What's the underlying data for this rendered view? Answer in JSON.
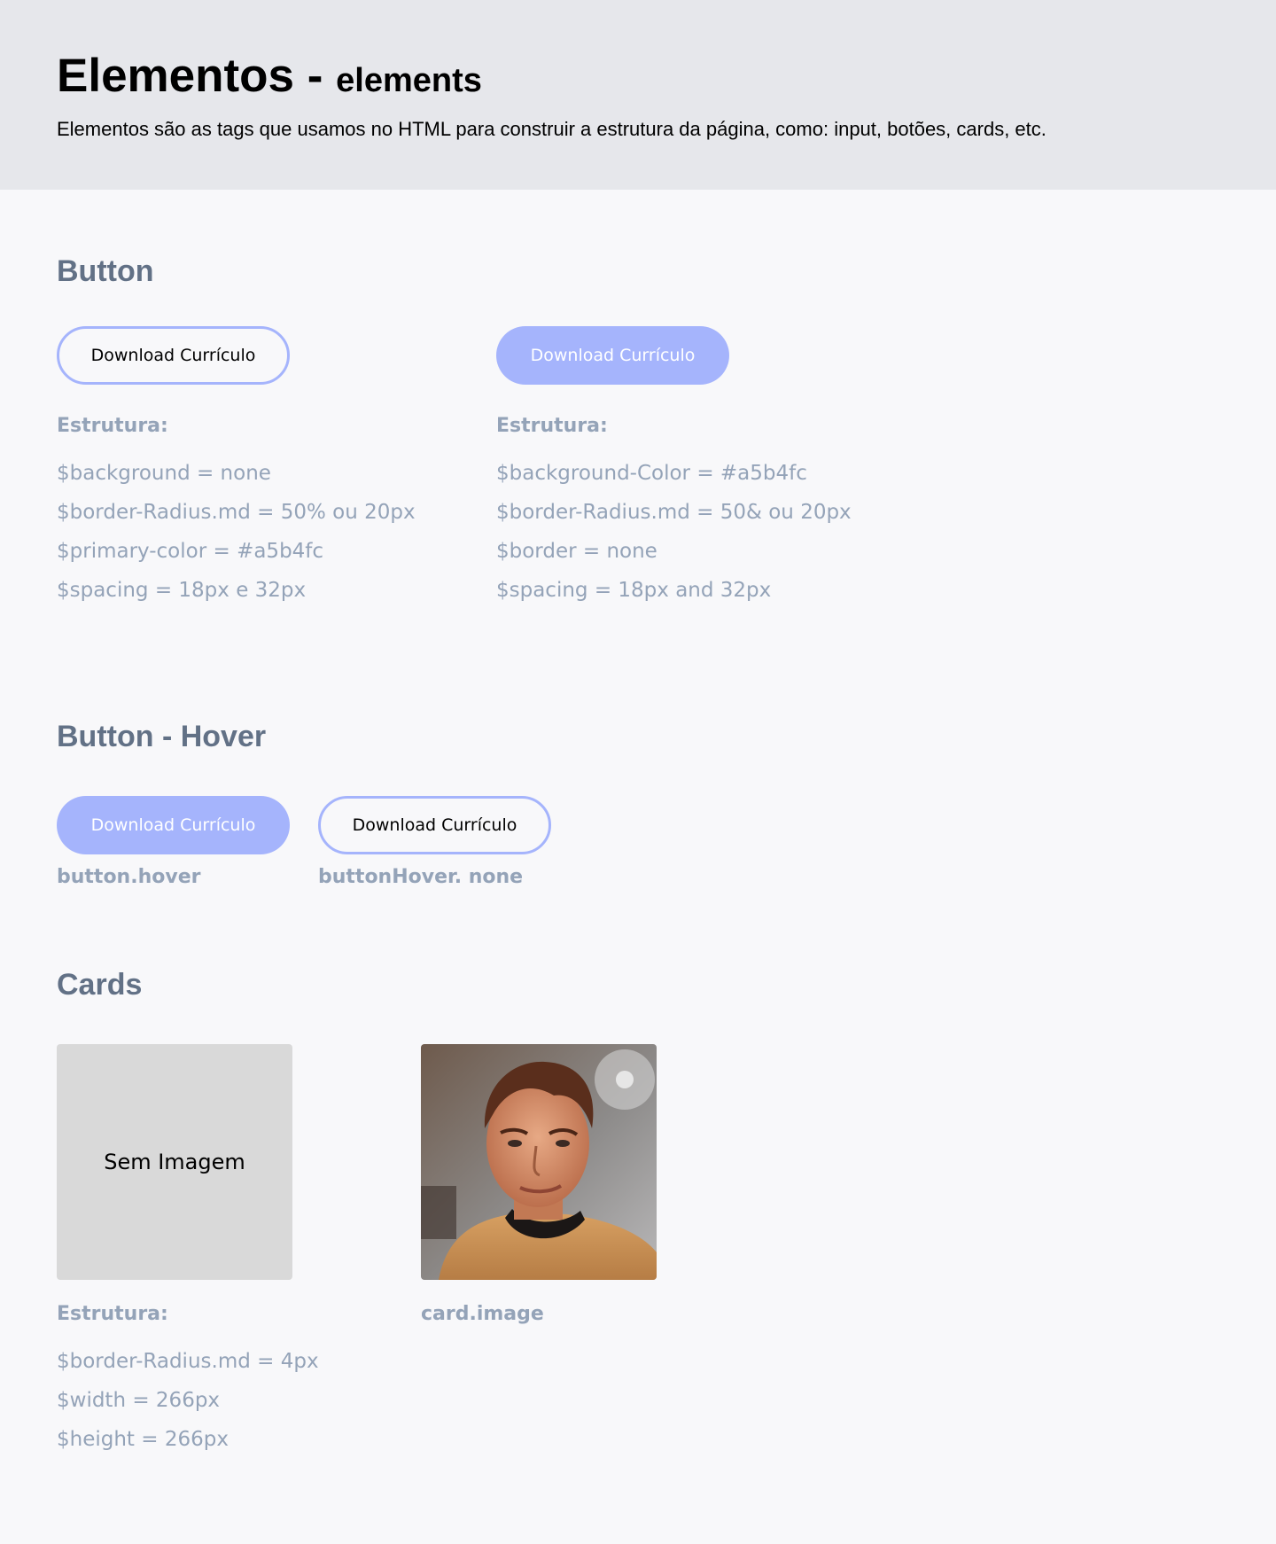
{
  "header": {
    "title": "Elementos -",
    "subtitle": "elements",
    "description": "Elementos são as tags que usamos no HTML para construir a estrutura da página, como: input, botões, cards, etc."
  },
  "colors": {
    "primary": "#a5b4fc",
    "header_bg": "#e6e7eb",
    "page_bg": "#f8f8fa",
    "heading": "#627186",
    "muted": "#94a3b8",
    "card_placeholder": "#d9d9d9"
  },
  "button_section": {
    "title": "Button",
    "outline": {
      "label": "Download Currículo",
      "structure_label": "Estrutura:",
      "specs": [
        "$background = none",
        "$border-Radius.md = 50% ou 20px",
        "$primary-color = #a5b4fc",
        "$spacing = 18px  e 32px"
      ]
    },
    "filled": {
      "label": "Download Currículo",
      "structure_label": "Estrutura:",
      "specs": [
        "$background-Color = #a5b4fc",
        "$border-Radius.md = 50& ou 20px",
        "$border = none",
        "$spacing = 18px and 32px"
      ]
    }
  },
  "hover_section": {
    "title": "Button - Hover",
    "hover": {
      "label": "Download Currículo",
      "caption": "button.hover"
    },
    "none": {
      "label": "Download Currículo",
      "caption": "buttonHover. none"
    }
  },
  "cards_section": {
    "title": "Cards",
    "placeholder_card": {
      "text": "Sem Imagem"
    },
    "image_card": {
      "caption": "card.image",
      "icon": "portrait-photo"
    },
    "structure_label": "Estrutura:",
    "specs": [
      "$border-Radius.md = 4px",
      "$width = 266px",
      "$height = 266px"
    ]
  }
}
